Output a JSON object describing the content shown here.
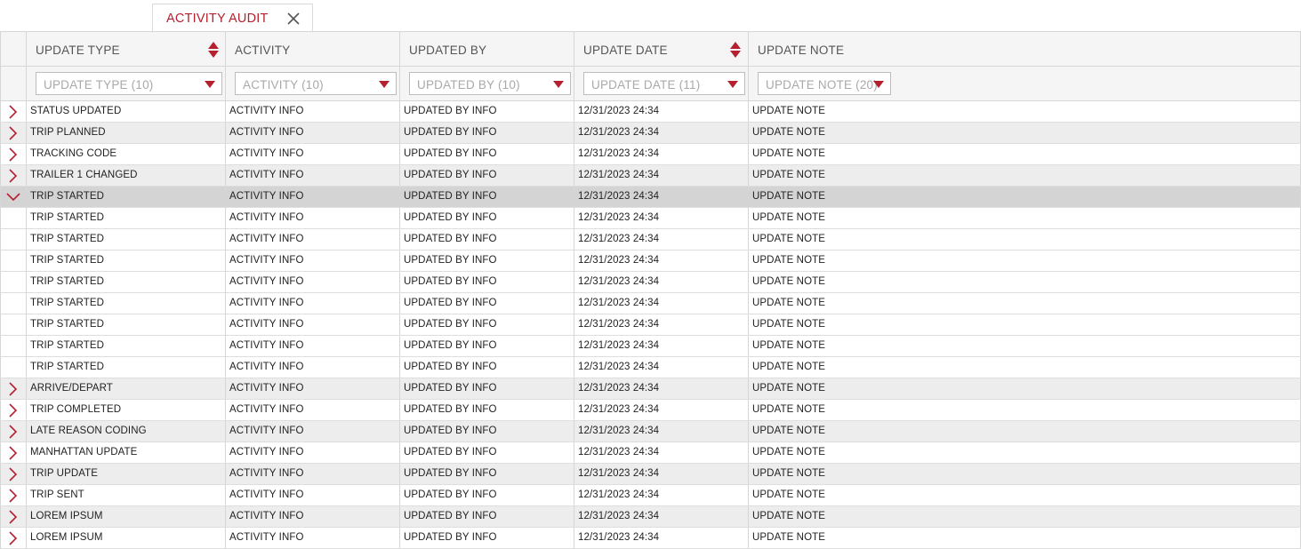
{
  "tab": {
    "label": "ACTIVITY AUDIT",
    "close_icon": "close-icon"
  },
  "colors": {
    "accent": "#b5202e",
    "header_bg": "#f5f5f6",
    "row_alt": "#ededee",
    "row_selected": "#d4d4d5"
  },
  "columns": [
    {
      "label": "UPDATE TYPE",
      "filter": "UPDATE TYPE (10)",
      "sortable": true
    },
    {
      "label": "ACTIVITY",
      "filter": "ACTIVITY (10)",
      "sortable": false
    },
    {
      "label": "UPDATED BY",
      "filter": "UPDATED BY (10)",
      "sortable": false
    },
    {
      "label": "UPDATE DATE",
      "filter": "UPDATE DATE (11)",
      "sortable": true
    },
    {
      "label": "UPDATE NOTE",
      "filter": "UPDATE NOTE (20)",
      "sortable": false
    }
  ],
  "rows": [
    {
      "state": "collapsed",
      "cells": [
        "STATUS UPDATED",
        "ACTIVITY INFO",
        "UPDATED BY INFO",
        "12/31/2023 24:34",
        "UPDATE NOTE"
      ]
    },
    {
      "state": "collapsed",
      "cells": [
        "TRIP PLANNED",
        "ACTIVITY INFO",
        "UPDATED BY INFO",
        "12/31/2023 24:34",
        "UPDATE NOTE"
      ]
    },
    {
      "state": "collapsed",
      "cells": [
        "TRACKING CODE",
        "ACTIVITY INFO",
        "UPDATED BY INFO",
        "12/31/2023 24:34",
        "UPDATE NOTE"
      ]
    },
    {
      "state": "collapsed",
      "cells": [
        "TRAILER 1 CHANGED",
        "ACTIVITY INFO",
        "UPDATED BY INFO",
        "12/31/2023 24:34",
        "UPDATE NOTE"
      ]
    },
    {
      "state": "expanded",
      "cells": [
        "TRIP STARTED",
        "ACTIVITY INFO",
        "UPDATED BY INFO",
        "12/31/2023 24:34",
        "UPDATE NOTE"
      ]
    },
    {
      "state": "child",
      "cells": [
        "TRIP STARTED",
        "ACTIVITY INFO",
        "UPDATED BY INFO",
        "12/31/2023 24:34",
        "UPDATE NOTE"
      ]
    },
    {
      "state": "child",
      "cells": [
        "TRIP STARTED",
        "ACTIVITY INFO",
        "UPDATED BY INFO",
        "12/31/2023 24:34",
        "UPDATE NOTE"
      ]
    },
    {
      "state": "child",
      "cells": [
        "TRIP STARTED",
        "ACTIVITY INFO",
        "UPDATED BY INFO",
        "12/31/2023 24:34",
        "UPDATE NOTE"
      ]
    },
    {
      "state": "child",
      "cells": [
        "TRIP STARTED",
        "ACTIVITY INFO",
        "UPDATED BY INFO",
        "12/31/2023 24:34",
        "UPDATE NOTE"
      ]
    },
    {
      "state": "child",
      "cells": [
        "TRIP STARTED",
        "ACTIVITY INFO",
        "UPDATED BY INFO",
        "12/31/2023 24:34",
        "UPDATE NOTE"
      ]
    },
    {
      "state": "child",
      "cells": [
        "TRIP STARTED",
        "ACTIVITY INFO",
        "UPDATED BY INFO",
        "12/31/2023 24:34",
        "UPDATE NOTE"
      ]
    },
    {
      "state": "child",
      "cells": [
        "TRIP STARTED",
        "ACTIVITY INFO",
        "UPDATED BY INFO",
        "12/31/2023 24:34",
        "UPDATE NOTE"
      ]
    },
    {
      "state": "child",
      "cells": [
        "TRIP STARTED",
        "ACTIVITY INFO",
        "UPDATED BY INFO",
        "12/31/2023 24:34",
        "UPDATE NOTE"
      ]
    },
    {
      "state": "collapsed",
      "cells": [
        "ARRIVE/DEPART",
        "ACTIVITY INFO",
        "UPDATED BY INFO",
        "12/31/2023 24:34",
        "UPDATE NOTE"
      ]
    },
    {
      "state": "collapsed",
      "cells": [
        "TRIP COMPLETED",
        "ACTIVITY INFO",
        "UPDATED BY INFO",
        "12/31/2023 24:34",
        "UPDATE NOTE"
      ]
    },
    {
      "state": "collapsed",
      "cells": [
        "LATE REASON CODING",
        "ACTIVITY INFO",
        "UPDATED BY INFO",
        "12/31/2023 24:34",
        "UPDATE NOTE"
      ]
    },
    {
      "state": "collapsed",
      "cells": [
        "MANHATTAN UPDATE",
        "ACTIVITY INFO",
        "UPDATED BY INFO",
        "12/31/2023 24:34",
        "UPDATE NOTE"
      ]
    },
    {
      "state": "collapsed",
      "cells": [
        "TRIP UPDATE",
        "ACTIVITY INFO",
        "UPDATED BY INFO",
        "12/31/2023 24:34",
        "UPDATE NOTE"
      ]
    },
    {
      "state": "collapsed",
      "cells": [
        "TRIP SENT",
        "ACTIVITY INFO",
        "UPDATED BY INFO",
        "12/31/2023 24:34",
        "UPDATE NOTE"
      ]
    },
    {
      "state": "collapsed",
      "cells": [
        "LOREM IPSUM",
        "ACTIVITY INFO",
        "UPDATED BY INFO",
        "12/31/2023 24:34",
        "UPDATE NOTE"
      ]
    },
    {
      "state": "collapsed",
      "cells": [
        "LOREM IPSUM",
        "ACTIVITY INFO",
        "UPDATED BY INFO",
        "12/31/2023 24:34",
        "UPDATE NOTE"
      ]
    }
  ]
}
